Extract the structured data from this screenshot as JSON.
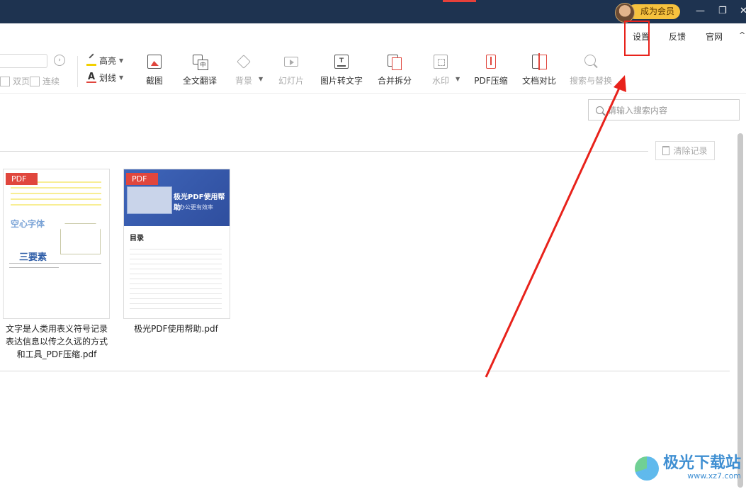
{
  "titlebar": {
    "vip_label": "成为会员",
    "min_glyph": "—",
    "restore_glyph": "❐",
    "close_glyph": "✕"
  },
  "menubar": {
    "items": [
      "设置",
      "反馈",
      "官网"
    ],
    "chevron": "^"
  },
  "toolbar": {
    "page_prev_glyph": "›",
    "double_page": "双页",
    "continuous": "连续",
    "highlight": "高亮",
    "underline": "划线",
    "tools": [
      {
        "label": "截图",
        "icon": "screenshot-icon",
        "enabled": true
      },
      {
        "label": "全文翻译",
        "icon": "translate-icon",
        "enabled": true
      },
      {
        "label": "背景",
        "icon": "background-icon",
        "enabled": false
      },
      {
        "label": "幻灯片",
        "icon": "slideshow-icon",
        "enabled": false
      },
      {
        "label": "图片转文字",
        "icon": "ocr-icon",
        "enabled": true
      },
      {
        "label": "合并拆分",
        "icon": "merge-split-icon",
        "enabled": true
      },
      {
        "label": "水印",
        "icon": "watermark-icon",
        "enabled": false
      },
      {
        "label": "PDF压缩",
        "icon": "compress-icon",
        "enabled": true
      },
      {
        "label": "文档对比",
        "icon": "compare-icon",
        "enabled": true
      },
      {
        "label": "搜索与替换",
        "icon": "search-replace-icon",
        "enabled": false
      }
    ]
  },
  "search": {
    "placeholder": "请输入搜索内容"
  },
  "recent": {
    "clear_label": "清除记录",
    "files": [
      {
        "badge": "PDF",
        "name": "文字是人类用表义符号记录表达信息以传之久远的方式和工具_PDF压缩.pdf",
        "name_lines": [
          "文字是人类用表义符号记录",
          "表达信息以传之久远的方式",
          "和工具_PDF压缩.pdf"
        ],
        "preview_big1": "空心字体",
        "preview_big2": "三要素"
      },
      {
        "badge": "PDF",
        "name": "极光PDF使用帮助.pdf",
        "name_lines": [
          "极光PDF使用帮助.pdf"
        ],
        "cover_title": "极光PDF使用帮助",
        "cover_sub": "让办公更有效率",
        "toc_title": "目录"
      }
    ]
  },
  "watermark": {
    "brand": "极光下载站",
    "url": "www.xz7.com"
  },
  "colors": {
    "titlebar": "#1e3350",
    "accent_red": "#e0463d",
    "vip_gold": "#f6c23e",
    "annotation_red": "#e8221b"
  }
}
